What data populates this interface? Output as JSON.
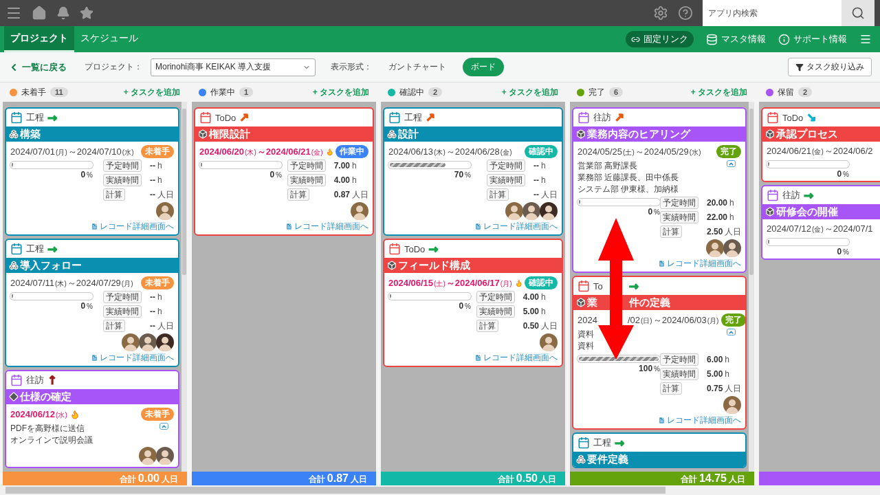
{
  "top_bar": {
    "search_placeholder": "アプリ内検索"
  },
  "nav": {
    "tabs": [
      {
        "label": "プロジェクト",
        "selected": true
      },
      {
        "label": "スケジュール",
        "selected": false
      }
    ],
    "links": [
      {
        "label": "固定リンク",
        "kind": "pill"
      },
      {
        "label": "マスタ情報",
        "kind": "plain"
      },
      {
        "label": "サポート情報",
        "kind": "plain"
      }
    ]
  },
  "toolbar": {
    "back": "一覧に戻る",
    "project_label": "プロジェクト：",
    "project_value": "Morinohi商事 KEIKAK 導入支援",
    "view_label": "表示形式：",
    "views": [
      {
        "label": "ガントチャート",
        "selected": false
      },
      {
        "label": "ボード",
        "selected": true
      }
    ],
    "filter": "タスク絞り込み"
  },
  "columns": [
    {
      "name": "未着手",
      "color": "#f7933e",
      "count": "11",
      "add": "+ タスクを追加",
      "total_label": "合計",
      "total": "0.00",
      "total_unit": "人日",
      "cards": [
        {
          "type": "工程",
          "color": "#0b8fb0",
          "kind": "cluster",
          "priority": {
            "symbol": "→",
            "color": "#16a34a"
          },
          "title": "構築",
          "overdue": false,
          "start": "2024/07/01",
          "start_day": "(月)",
          "sep": "～",
          "end": "2024/07/10",
          "end_day": "(水)",
          "status": {
            "label": "未着手",
            "color": "#f7933e"
          },
          "level": 0,
          "percent": "0",
          "percent_unit": "%",
          "hours": [
            {
              "label": "予定時間",
              "value": "--",
              "unit": "h"
            },
            {
              "label": "実績時間",
              "value": "--",
              "unit": "h"
            },
            {
              "label": "計算",
              "value": "--",
              "unit": "人日"
            }
          ],
          "avatars": [
            {
              "kind": "avatar"
            }
          ],
          "link": "レコード詳細画面へ"
        },
        {
          "type": "工程",
          "color": "#0b8fb0",
          "kind": "cluster",
          "priority": {
            "symbol": "→",
            "color": "#16a34a"
          },
          "title": "導入フォロー",
          "overdue": false,
          "start": "2024/07/11",
          "start_day": "(木)",
          "sep": "～",
          "end": "2024/07/29",
          "end_day": "(月)",
          "status": {
            "label": "未着手",
            "color": "#f7933e"
          },
          "level": 0,
          "percent": "0",
          "percent_unit": "%",
          "hours": [
            {
              "label": "予定時間",
              "value": "--",
              "unit": "h"
            },
            {
              "label": "実績時間",
              "value": "--",
              "unit": "h"
            },
            {
              "label": "計算",
              "value": "--",
              "unit": "人日"
            }
          ],
          "avatars": [
            {
              "kind": "avatar"
            },
            {
              "kind": "avatar"
            },
            {
              "kind": "avatar"
            }
          ],
          "link": "レコード詳細画面へ"
        },
        {
          "type": "往訪",
          "color": "#a855f7",
          "kind": "milestone",
          "priority": {
            "symbol": "↑",
            "color": "#991b1b"
          },
          "title": "仕様の確定",
          "overdue": true,
          "start": "2024/06/12",
          "start_day": "(水)",
          "status": {
            "label": "未着手",
            "color": "#f7933e"
          },
          "notes": [
            "PDFを高野様に送信",
            "オンラインで説明会議"
          ],
          "avatars": [
            {
              "kind": "avatar"
            },
            {
              "kind": "avatar"
            }
          ]
        }
      ]
    },
    {
      "name": "作業中",
      "color": "#3b82f6",
      "count": "1",
      "add": "+ タスクを追加",
      "total_label": "合計",
      "total": "0.87",
      "total_unit": "人日",
      "cards": [
        {
          "type": "ToDo",
          "color": "#ef4444",
          "kind": "cube",
          "priority": {
            "symbol": "↗",
            "color": "#ea580c"
          },
          "title": "権限設計",
          "overdue": true,
          "start": "2024/06/20",
          "start_day": "(木)",
          "sep": "～",
          "end": "2024/06/21",
          "end_day": "(金)",
          "status": {
            "label": "作業中",
            "color": "#3b82f6"
          },
          "level": 0,
          "percent": "0",
          "percent_unit": "%",
          "hours": [
            {
              "label": "予定時間",
              "value": "7.00",
              "unit": "h"
            },
            {
              "label": "実績時間",
              "value": "4.00",
              "unit": "h"
            },
            {
              "label": "計算",
              "value": "0.87",
              "unit": "人日"
            }
          ],
          "avatars": [
            {
              "kind": "avatar"
            }
          ],
          "link": "レコード詳細画面へ"
        }
      ]
    },
    {
      "name": "確認中",
      "color": "#14b8a6",
      "count": "2",
      "add": "+ タスクを追加",
      "total_label": "合計",
      "total": "0.50",
      "total_unit": "人日",
      "cards": [
        {
          "type": "工程",
          "color": "#0b8fb0",
          "kind": "cluster",
          "priority": {
            "symbol": "↗",
            "color": "#ea580c"
          },
          "title": "設計",
          "overdue": false,
          "start": "2024/06/13",
          "start_day": "(木)",
          "sep": "～",
          "end": "2024/06/28",
          "end_day": "(金)",
          "status": {
            "label": "確認中",
            "color": "#14b8a6"
          },
          "level": 0.7,
          "percent": "70",
          "percent_unit": "%",
          "hours": [
            {
              "label": "予定時間",
              "value": "--",
              "unit": "h"
            },
            {
              "label": "実績時間",
              "value": "--",
              "unit": "h"
            },
            {
              "label": "計算",
              "value": "--",
              "unit": "人日"
            }
          ],
          "avatars": [
            {
              "kind": "avatar"
            },
            {
              "kind": "avatar"
            },
            {
              "kind": "avatar"
            }
          ],
          "link": "レコード詳細画面へ"
        },
        {
          "type": "ToDo",
          "color": "#ef4444",
          "kind": "cube",
          "priority": {
            "symbol": "→",
            "color": "#16a34a"
          },
          "title": "フィールド構成",
          "overdue": true,
          "start": "2024/06/15",
          "start_day": "(土)",
          "sep": "～",
          "end": "2024/06/17",
          "end_day": "(月)",
          "status": {
            "label": "確認中",
            "color": "#14b8a6"
          },
          "level": 0,
          "percent": "0",
          "percent_unit": "%",
          "hours": [
            {
              "label": "予定時間",
              "value": "4.00",
              "unit": "h"
            },
            {
              "label": "実績時間",
              "value": "5.00",
              "unit": "h"
            },
            {
              "label": "計算",
              "value": "0.50",
              "unit": "人日"
            }
          ],
          "avatars": [
            {
              "kind": "avatar"
            }
          ],
          "link": "レコード詳細画面へ"
        }
      ]
    },
    {
      "name": "完了",
      "color": "#65a30d",
      "count": "6",
      "add": "+ タスクを追加",
      "total_label": "合計",
      "total": "14.75",
      "total_unit": "人日",
      "cards": [
        {
          "type": "往訪",
          "color": "#a855f7",
          "kind": "cube",
          "priority": {
            "symbol": "↗",
            "color": "#ea580c"
          },
          "title": "業務内容のヒアリング",
          "overdue": false,
          "start": "2024/05/25",
          "start_day": "(土)",
          "sep": "～",
          "end": "2024/05/29",
          "end_day": "(水)",
          "status": {
            "label": "完了",
            "color": "#65a30d"
          },
          "notes": [
            "営業部 高野課長",
            "業務部 近藤課長、田中係長",
            "システム部 伊東様、加納様"
          ],
          "level": 0,
          "percent": "0",
          "percent_unit": "%",
          "hours": [
            {
              "label": "予定時間",
              "value": "20.00",
              "unit": "h"
            },
            {
              "label": "実績時間",
              "value": "22.00",
              "unit": "h"
            },
            {
              "label": "計算",
              "value": "2.50",
              "unit": "人日"
            }
          ],
          "avatars": [
            {
              "kind": "avatar"
            },
            {
              "kind": "avatar"
            }
          ],
          "link": "レコード詳細画面へ"
        },
        {
          "type": "To",
          "color": "#ef4444",
          "kind": "cube",
          "priority": {
            "symbol": "→",
            "color": "#16a34a"
          },
          "title": "業",
          "title_rest": "件の定義",
          "overdue": false,
          "start": "2024",
          "start_rest": "/02",
          "start_day": "(日)",
          "sep": "～",
          "end": "2024/06/03",
          "end_day": "(月)",
          "status": {
            "label": "完了",
            "color": "#65a30d"
          },
          "notes": [
            "資料",
            "資料"
          ],
          "level": 1,
          "percent": "100",
          "percent_unit": "%",
          "hours": [
            {
              "label": "予定時間",
              "value": "6.00",
              "unit": "h"
            },
            {
              "label": "実績時間",
              "value": "5.00",
              "unit": "h"
            },
            {
              "label": "計算",
              "value": "0.75",
              "unit": "人日"
            }
          ],
          "avatars": [
            {
              "kind": "avatar"
            }
          ],
          "link": "レコード詳細画面へ",
          "overlay": {
            "kind": "double-arrow"
          }
        },
        {
          "type": "工程",
          "color": "#0b8fb0",
          "kind": "cluster",
          "priority": {
            "symbol": "→",
            "color": "#16a34a"
          },
          "title": "要件定義"
        }
      ]
    },
    {
      "name": "保留",
      "color": "#a855f7",
      "count": "2",
      "cards": [
        {
          "type": "ToDo",
          "color": "#ef4444",
          "kind": "cube",
          "priority": {
            "symbol": "↘",
            "color": "#06b6d4"
          },
          "title": "承認プロセス",
          "overdue": false,
          "start": "2024/06/21",
          "start_day": "(金)",
          "sep": "～",
          "end": "2024/06/2",
          "level": 0,
          "percent": "0",
          "percent_unit": "%"
        },
        {
          "type": "往訪",
          "color": "#a855f7",
          "kind": "cube",
          "priority": {
            "symbol": "→",
            "color": "#16a34a"
          },
          "title": "研修会の開催",
          "overdue": false,
          "start": "2024/07/12",
          "start_day": "(金)",
          "sep": "～",
          "end": "2024/07/1",
          "level": 0,
          "percent": "0",
          "percent_unit": "%"
        }
      ]
    }
  ]
}
